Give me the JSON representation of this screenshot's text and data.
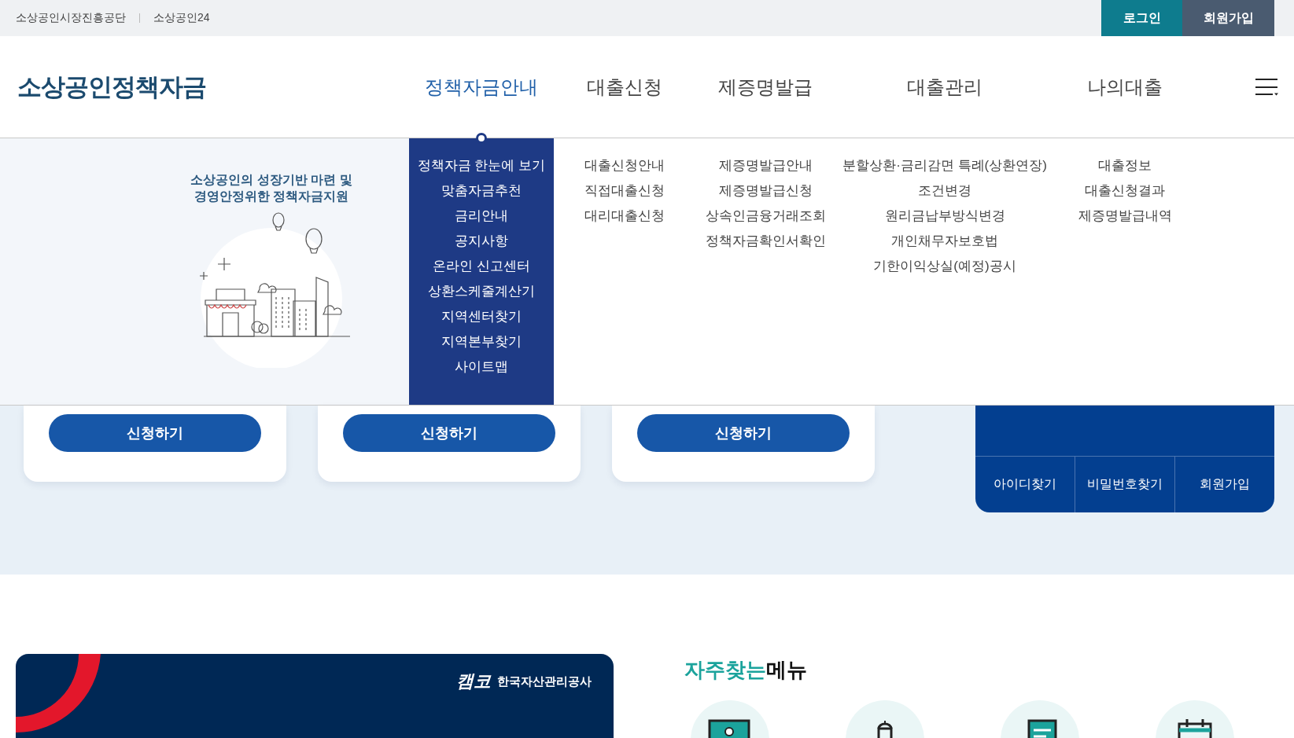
{
  "top_links": [
    "소상공인시장진흥공단",
    "소상공인24"
  ],
  "auth_buttons": [
    {
      "label": "로그인",
      "kind": "login"
    },
    {
      "label": "회원가입",
      "kind": "join"
    }
  ],
  "logo": "소상공인정책자금",
  "nav": [
    {
      "label": "정책자금안내",
      "selected": true,
      "submenu": [
        "정책자금 한눈에 보기",
        "맞춤자금추천",
        "금리안내",
        "공지사항",
        "온라인 신고센터",
        "상환스케줄계산기",
        "지역센터찾기",
        "지역본부찾기",
        "사이트맵"
      ]
    },
    {
      "label": "대출신청",
      "selected": false,
      "submenu": [
        "대출신청안내",
        "직접대출신청",
        "대리대출신청"
      ]
    },
    {
      "label": "제증명발급",
      "selected": false,
      "submenu": [
        "제증명발급안내",
        "제증명발급신청",
        "상속인금융거래조회",
        "정책자금확인서확인"
      ]
    },
    {
      "label": "대출관리",
      "selected": false,
      "submenu": [
        "분할상환·금리감면 특례(상환연장)",
        "조건변경",
        "원리금납부방식변경",
        "개인채무자보호법",
        "기한이익상실(예정)공시"
      ]
    },
    {
      "label": "나의대출",
      "selected": false,
      "submenu": [
        "대출정보",
        "대출신청결과",
        "제증명발급내역"
      ]
    }
  ],
  "menu_caption": [
    "소상공인의 성장기반 마련 및",
    "경영안정위한 정책자금지원"
  ],
  "cards": [
    {
      "button": "신청하기"
    },
    {
      "button": "신청하기"
    },
    {
      "button": "신청하기"
    }
  ],
  "account_links": [
    "아이디찾기",
    "비밀번호찾기",
    "회원가입"
  ],
  "banner": {
    "logo_mark": "캠코",
    "org": "한국자산관리공사"
  },
  "frequent_menu": {
    "title_highlight": "자주찾는",
    "title_rest": "메뉴",
    "icons": [
      {
        "kind": "id-card"
      },
      {
        "kind": "chef"
      },
      {
        "kind": "document"
      },
      {
        "kind": "calendar"
      }
    ]
  }
}
